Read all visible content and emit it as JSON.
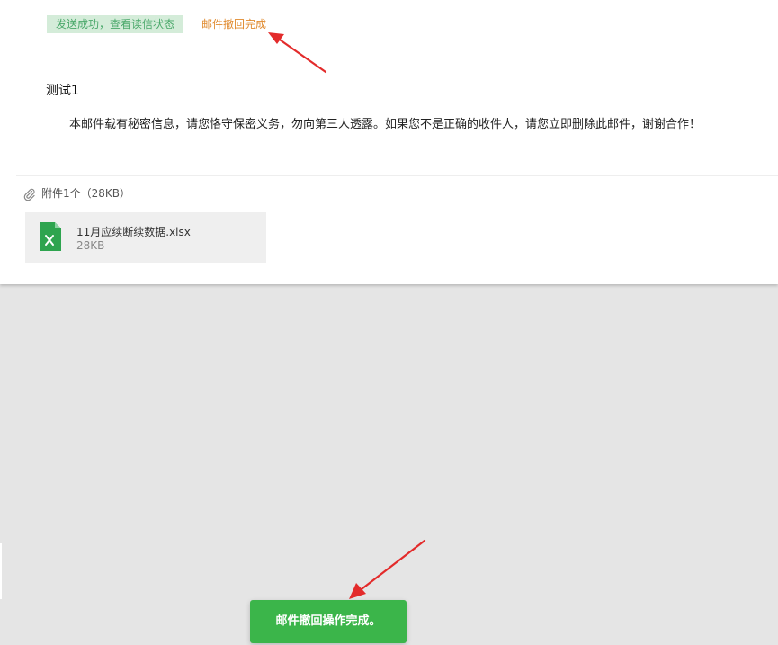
{
  "status": {
    "sent_badge": "发送成功，查看读信状态",
    "recall_link": "邮件撤回完成"
  },
  "mail": {
    "subject": "测试1",
    "body": "本邮件载有秘密信息，请您恪守保密义务，勿向第三人透露。如果您不是正确的收件人，请您立即删除此邮件，谢谢合作！"
  },
  "attachments": {
    "header": "附件1个（28KB）",
    "items": [
      {
        "name": "11月应续断续数据.xlsx",
        "size": "28KB",
        "icon": "excel-file-icon"
      }
    ]
  },
  "toast": {
    "message": "邮件撤回操作完成。"
  },
  "colors": {
    "badge_bg": "#d4ecd9",
    "badge_text": "#4aa86a",
    "recall_link": "#e08a2e",
    "toast_bg": "#3bb54a",
    "excel_green": "#2ea44f",
    "annotation_arrow": "#e32b2b"
  }
}
